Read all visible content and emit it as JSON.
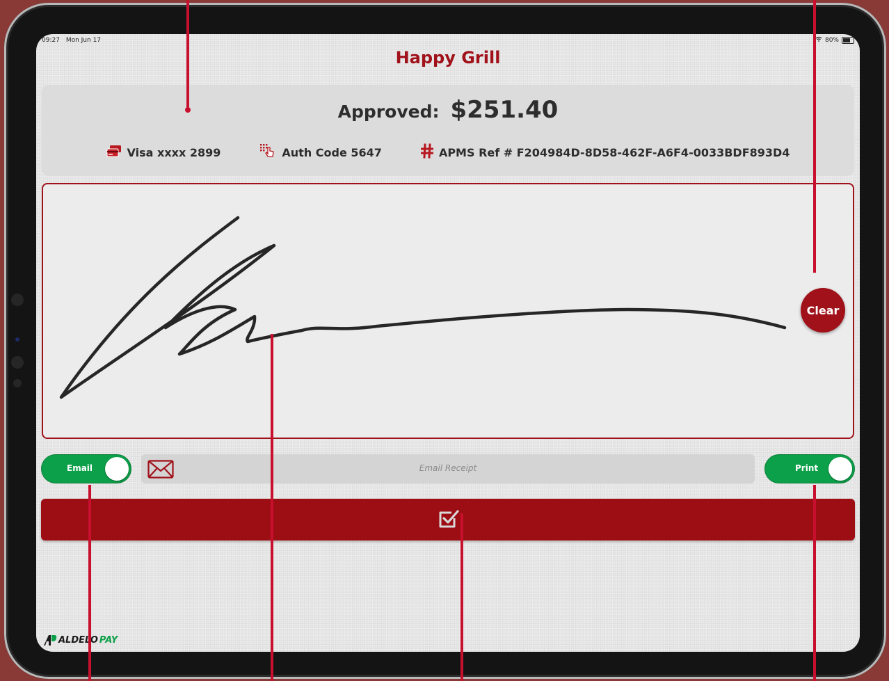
{
  "status_bar": {
    "time": "09:27",
    "date": "Mon Jun 17",
    "battery": "80%"
  },
  "app": {
    "title": "Happy Grill"
  },
  "summary": {
    "approved_label": "Approved:",
    "amount": "$251.40",
    "card": "Visa xxxx 2899",
    "auth_code": "Auth Code 5647",
    "apms_ref": "APMS Ref # F204984D-8D58-462F-A6F4-0033BDF893D4"
  },
  "signature": {
    "clear_label": "Clear"
  },
  "receipt": {
    "email_toggle_label": "Email",
    "email_placeholder": "Email Receipt",
    "email_value": "",
    "print_toggle_label": "Print",
    "email_on": true,
    "print_on": true
  },
  "icons": {
    "card": "credit-card-icon",
    "auth": "touch-keypad-icon",
    "ref": "hash-icon",
    "email": "envelope-icon",
    "submit": "checkbox-check-icon"
  },
  "brand": {
    "name_part1": "ALDELO",
    "name_part2": "PAY"
  },
  "colors": {
    "accent_red": "#a0111a",
    "toggle_green": "#0da04a",
    "button_red": "#9c0d14"
  }
}
